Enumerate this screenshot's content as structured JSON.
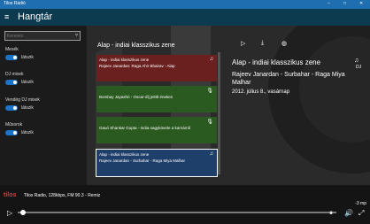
{
  "app": {
    "window_title": "Tilos Rádió",
    "header_title": "Hangtár"
  },
  "icons": {
    "menu": "hamburger-icon",
    "filter": "filter-icon",
    "window_min": "minimize-icon",
    "window_max": "maximize-icon",
    "window_close": "close-icon"
  },
  "sidebar": {
    "search_placeholder": "Keresés",
    "groups": [
      {
        "label": "Mesék",
        "toggle": "látszik"
      },
      {
        "label": "DJ mixek",
        "toggle": "látszik"
      },
      {
        "label": "Vendég DJ mixek",
        "toggle": "látszik"
      },
      {
        "label": "Műsorok",
        "toggle": "látszik"
      }
    ]
  },
  "list": {
    "title": "Alap - indiai klasszikus zene",
    "items": [
      {
        "line1": "Alap - indiai klasszikus zene",
        "line2": "Rajeev Janardan: Raga Ahir Bhairav - Alap",
        "color": "#6b2020",
        "icon": "dj-icon"
      },
      {
        "line1": "",
        "line2": "Bombay Jayashri - Oscar-díj jelölt énekes",
        "color": "#2a5a20",
        "icon": "microphone-icon"
      },
      {
        "line1": "",
        "line2": "Gauri Shankar Gupta - India nagykövete a karnárról",
        "color": "#2a5a20",
        "icon": "microphone-icon"
      },
      {
        "line1": "Alap - indiai klasszikus zene",
        "line2": "Rajeev Janardan - Surbahar - Raga Miya Malhar",
        "color": "#1f3f6b",
        "icon": "dj-icon"
      }
    ]
  },
  "detail": {
    "title": "Alap - indiai klasszikus zene",
    "artist_line1": "Rajeev Janardan - Surbahar - Raga Miya",
    "artist_line2": "Malhar",
    "date": "2012. július 8., vasárnap",
    "dj_label": "DJ"
  },
  "player": {
    "logo": "tilos",
    "info": "Tilos Radio, 128kbps, FM 90.3  -  Remiz",
    "time": "-3 mp",
    "progress": 0.02
  }
}
